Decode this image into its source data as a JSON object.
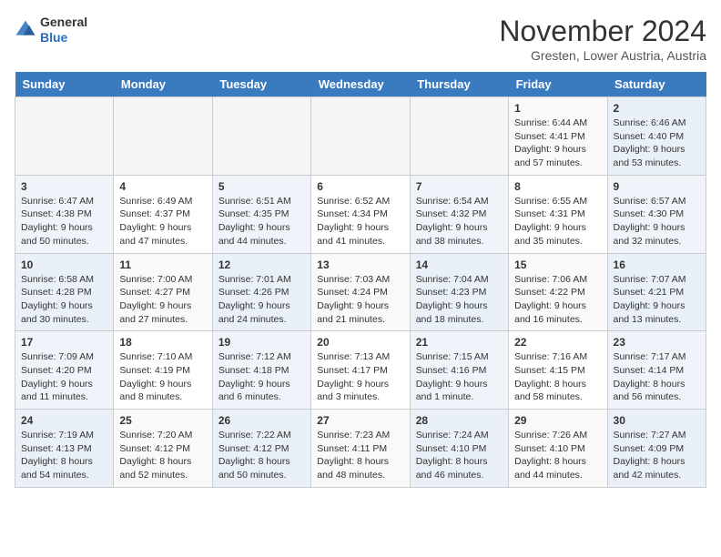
{
  "header": {
    "logo_line1": "General",
    "logo_line2": "Blue",
    "month": "November 2024",
    "location": "Gresten, Lower Austria, Austria"
  },
  "weekdays": [
    "Sunday",
    "Monday",
    "Tuesday",
    "Wednesday",
    "Thursday",
    "Friday",
    "Saturday"
  ],
  "weeks": [
    [
      {
        "day": "",
        "info": ""
      },
      {
        "day": "",
        "info": ""
      },
      {
        "day": "",
        "info": ""
      },
      {
        "day": "",
        "info": ""
      },
      {
        "day": "",
        "info": ""
      },
      {
        "day": "1",
        "info": "Sunrise: 6:44 AM\nSunset: 4:41 PM\nDaylight: 9 hours and 57 minutes."
      },
      {
        "day": "2",
        "info": "Sunrise: 6:46 AM\nSunset: 4:40 PM\nDaylight: 9 hours and 53 minutes."
      }
    ],
    [
      {
        "day": "3",
        "info": "Sunrise: 6:47 AM\nSunset: 4:38 PM\nDaylight: 9 hours and 50 minutes."
      },
      {
        "day": "4",
        "info": "Sunrise: 6:49 AM\nSunset: 4:37 PM\nDaylight: 9 hours and 47 minutes."
      },
      {
        "day": "5",
        "info": "Sunrise: 6:51 AM\nSunset: 4:35 PM\nDaylight: 9 hours and 44 minutes."
      },
      {
        "day": "6",
        "info": "Sunrise: 6:52 AM\nSunset: 4:34 PM\nDaylight: 9 hours and 41 minutes."
      },
      {
        "day": "7",
        "info": "Sunrise: 6:54 AM\nSunset: 4:32 PM\nDaylight: 9 hours and 38 minutes."
      },
      {
        "day": "8",
        "info": "Sunrise: 6:55 AM\nSunset: 4:31 PM\nDaylight: 9 hours and 35 minutes."
      },
      {
        "day": "9",
        "info": "Sunrise: 6:57 AM\nSunset: 4:30 PM\nDaylight: 9 hours and 32 minutes."
      }
    ],
    [
      {
        "day": "10",
        "info": "Sunrise: 6:58 AM\nSunset: 4:28 PM\nDaylight: 9 hours and 30 minutes."
      },
      {
        "day": "11",
        "info": "Sunrise: 7:00 AM\nSunset: 4:27 PM\nDaylight: 9 hours and 27 minutes."
      },
      {
        "day": "12",
        "info": "Sunrise: 7:01 AM\nSunset: 4:26 PM\nDaylight: 9 hours and 24 minutes."
      },
      {
        "day": "13",
        "info": "Sunrise: 7:03 AM\nSunset: 4:24 PM\nDaylight: 9 hours and 21 minutes."
      },
      {
        "day": "14",
        "info": "Sunrise: 7:04 AM\nSunset: 4:23 PM\nDaylight: 9 hours and 18 minutes."
      },
      {
        "day": "15",
        "info": "Sunrise: 7:06 AM\nSunset: 4:22 PM\nDaylight: 9 hours and 16 minutes."
      },
      {
        "day": "16",
        "info": "Sunrise: 7:07 AM\nSunset: 4:21 PM\nDaylight: 9 hours and 13 minutes."
      }
    ],
    [
      {
        "day": "17",
        "info": "Sunrise: 7:09 AM\nSunset: 4:20 PM\nDaylight: 9 hours and 11 minutes."
      },
      {
        "day": "18",
        "info": "Sunrise: 7:10 AM\nSunset: 4:19 PM\nDaylight: 9 hours and 8 minutes."
      },
      {
        "day": "19",
        "info": "Sunrise: 7:12 AM\nSunset: 4:18 PM\nDaylight: 9 hours and 6 minutes."
      },
      {
        "day": "20",
        "info": "Sunrise: 7:13 AM\nSunset: 4:17 PM\nDaylight: 9 hours and 3 minutes."
      },
      {
        "day": "21",
        "info": "Sunrise: 7:15 AM\nSunset: 4:16 PM\nDaylight: 9 hours and 1 minute."
      },
      {
        "day": "22",
        "info": "Sunrise: 7:16 AM\nSunset: 4:15 PM\nDaylight: 8 hours and 58 minutes."
      },
      {
        "day": "23",
        "info": "Sunrise: 7:17 AM\nSunset: 4:14 PM\nDaylight: 8 hours and 56 minutes."
      }
    ],
    [
      {
        "day": "24",
        "info": "Sunrise: 7:19 AM\nSunset: 4:13 PM\nDaylight: 8 hours and 54 minutes."
      },
      {
        "day": "25",
        "info": "Sunrise: 7:20 AM\nSunset: 4:12 PM\nDaylight: 8 hours and 52 minutes."
      },
      {
        "day": "26",
        "info": "Sunrise: 7:22 AM\nSunset: 4:12 PM\nDaylight: 8 hours and 50 minutes."
      },
      {
        "day": "27",
        "info": "Sunrise: 7:23 AM\nSunset: 4:11 PM\nDaylight: 8 hours and 48 minutes."
      },
      {
        "day": "28",
        "info": "Sunrise: 7:24 AM\nSunset: 4:10 PM\nDaylight: 8 hours and 46 minutes."
      },
      {
        "day": "29",
        "info": "Sunrise: 7:26 AM\nSunset: 4:10 PM\nDaylight: 8 hours and 44 minutes."
      },
      {
        "day": "30",
        "info": "Sunrise: 7:27 AM\nSunset: 4:09 PM\nDaylight: 8 hours and 42 minutes."
      }
    ]
  ]
}
